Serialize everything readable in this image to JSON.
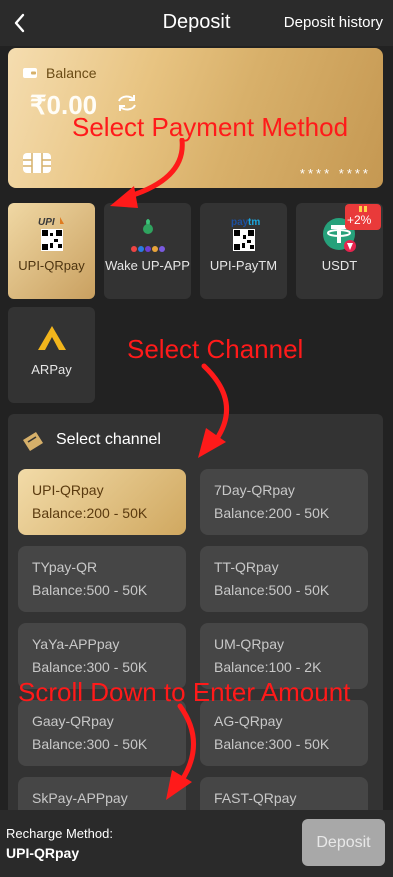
{
  "header": {
    "title": "Deposit",
    "history_link": "Deposit history"
  },
  "balance_card": {
    "label": "Balance",
    "amount": "₹0.00",
    "card_number": "****  ****"
  },
  "payment_methods": [
    {
      "label": "UPI-QRpay",
      "icon": "upi-qr-icon",
      "active": true
    },
    {
      "label": "Wake UP-APP",
      "icon": "upi-apps-icon",
      "active": false
    },
    {
      "label": "UPI-PayTM",
      "icon": "paytm-qr-icon",
      "active": false
    },
    {
      "label": "USDT",
      "icon": "tether-icon",
      "badge": "+2%",
      "active": false
    },
    {
      "label": "ARPay",
      "icon": "arpay-icon",
      "active": false
    }
  ],
  "channel_section": {
    "title": "Select channel",
    "channels": [
      {
        "name": "UPI-QRpay",
        "balance": "Balance:200 - 50K",
        "active": true
      },
      {
        "name": "7Day-QRpay",
        "balance": "Balance:200 - 50K"
      },
      {
        "name": "TYpay-QR",
        "balance": "Balance:500 - 50K"
      },
      {
        "name": "TT-QRpay",
        "balance": "Balance:500 - 50K"
      },
      {
        "name": "YaYa-APPpay",
        "balance": "Balance:300 - 50K"
      },
      {
        "name": "UM-QRpay",
        "balance": "Balance:100 - 2K"
      },
      {
        "name": "Gaay-QRpay",
        "balance": "Balance:300 - 50K"
      },
      {
        "name": "AG-QRpay",
        "balance": "Balance:300 - 50K"
      },
      {
        "name": "SkPay-APPpay",
        "balance": ""
      },
      {
        "name": "FAST-QRpay",
        "balance": ""
      }
    ]
  },
  "annotations": {
    "select_payment": "Select Payment Method",
    "select_channel": "Select Channel",
    "scroll_down": "Scroll Down to Enter Amount"
  },
  "footer": {
    "method_label": "Recharge Method:",
    "method_value": "UPI-QRpay",
    "deposit_button": "Deposit"
  },
  "colors": {
    "gold_light": "#f0d8a4",
    "gold_dark": "#c9a060",
    "annotation_red": "#ff1a1a",
    "usdt_green": "#26a17b"
  }
}
